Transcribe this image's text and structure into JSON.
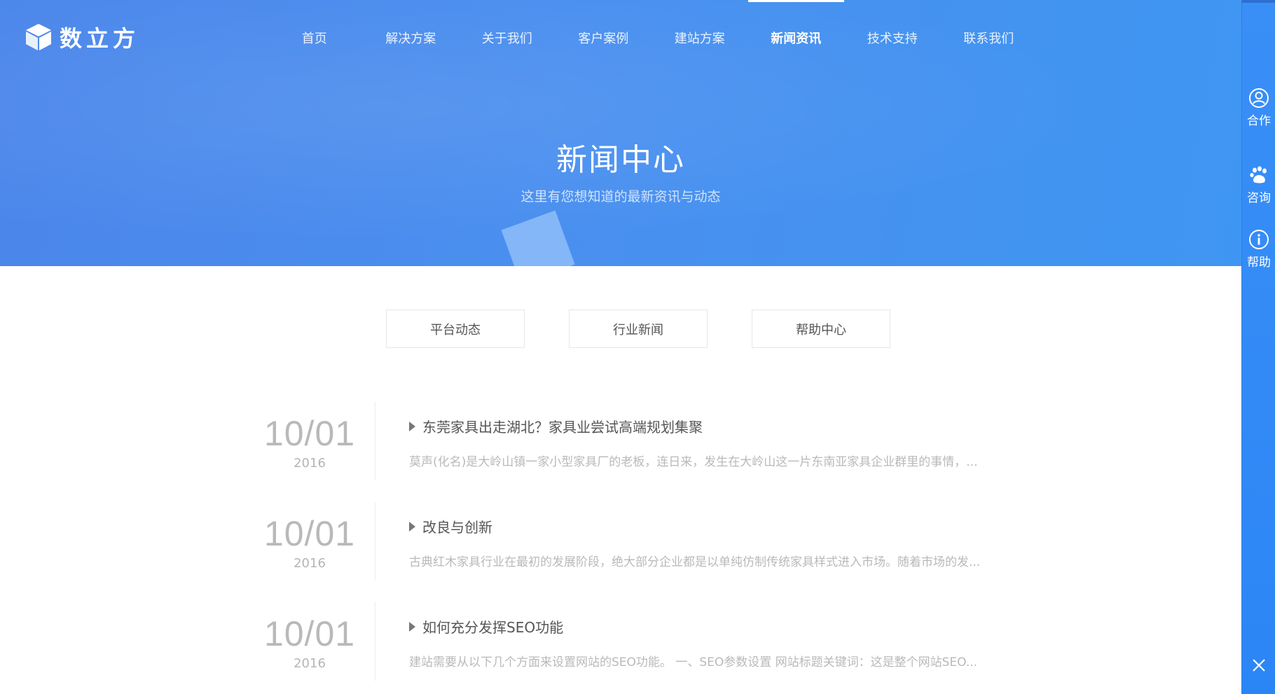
{
  "header": {
    "logo_text": "数立方",
    "nav": [
      {
        "label": "首页"
      },
      {
        "label": "解决方案"
      },
      {
        "label": "关于我们"
      },
      {
        "label": "客户案例"
      },
      {
        "label": "建站方案"
      },
      {
        "label": "新闻资讯"
      },
      {
        "label": "技术支持"
      },
      {
        "label": "联系我们"
      }
    ],
    "active_nav": "新闻资讯"
  },
  "hero": {
    "title": "新闻中心",
    "subtitle": "这里有您想知道的最新资讯与动态"
  },
  "sidebar": {
    "items": [
      {
        "label": "合作",
        "icon": "user-icon"
      },
      {
        "label": "咨询",
        "icon": "paw-chat-icon"
      },
      {
        "label": "帮助",
        "icon": "info-icon"
      }
    ],
    "close_icon": "close-icon"
  },
  "tabs": [
    {
      "label": "平台动态"
    },
    {
      "label": "行业新闻"
    },
    {
      "label": "帮助中心"
    }
  ],
  "news": [
    {
      "month_day": "10/01",
      "year": "2016",
      "title": "东莞家具出走湖北？家具业尝试高端规划集聚",
      "excerpt": "莫声(化名)是大岭山镇一家小型家具厂的老板，连日来，发生在大岭山这一片东南亚家具企业群里的事情，..."
    },
    {
      "month_day": "10/01",
      "year": "2016",
      "title": "改良与创新",
      "excerpt": "古典红木家具行业在最初的发展阶段，绝大部分企业都是以单纯仿制传统家具样式进入市场。随着市场的发..."
    },
    {
      "month_day": "10/01",
      "year": "2016",
      "title": "如何充分发挥SEO功能",
      "excerpt": "建站需要从以下几个方面来设置网站的SEO功能。 一、SEO参数设置 网站标题关键词：这是整个网站SEO..."
    }
  ],
  "colors": {
    "hero_gradient_start": "#4b86ea",
    "hero_gradient_end": "#3f96f2",
    "sidebar": "#2b86f5",
    "date_gray": "#b9b9b9"
  }
}
